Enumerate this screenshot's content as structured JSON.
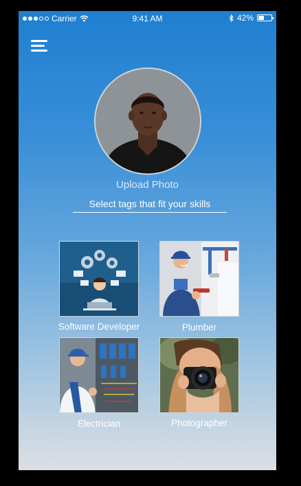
{
  "status_bar": {
    "carrier": "Carrier",
    "time": "9:41 AM",
    "battery": "42%",
    "battery_level": 0.42
  },
  "profile": {
    "upload_label": "Upload Photo"
  },
  "tags": {
    "prompt": "Select tags that fit your skills",
    "items": [
      {
        "label": "Software Developer"
      },
      {
        "label": "Plumber"
      },
      {
        "label": "Electrician"
      },
      {
        "label": "Photographer"
      }
    ]
  }
}
